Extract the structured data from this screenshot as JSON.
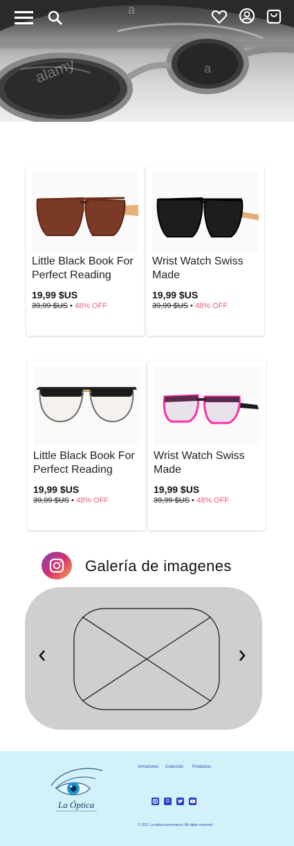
{
  "header": {
    "menu_icon": "menu-icon",
    "search_icon": "search-icon",
    "wishlist_icon": "heart-icon",
    "account_icon": "account-icon",
    "cart_icon": "shopping-bag-icon",
    "hero_watermark": "alamy"
  },
  "products": [
    {
      "title": "Little Black Book For Perfect Reading",
      "price": "19,99 $US",
      "old_price": "39,99 $US",
      "separator": "•",
      "discount": "48% OFF",
      "image": "brown-wood-sunglasses"
    },
    {
      "title": "Wrist Watch Swiss Made",
      "price": "19,99 $US",
      "old_price": "39,99 $US",
      "separator": "•",
      "discount": "48% OFF",
      "image": "black-wood-sunglasses"
    },
    {
      "title": "Little Black Book For Perfect Reading",
      "price": "19,99 $US",
      "old_price": "39,99 $US",
      "separator": "•",
      "discount": "48% OFF",
      "image": "browline-eyeglasses"
    },
    {
      "title": "Wrist Watch Swiss Made",
      "price": "19,99 $US",
      "old_price": "39,99 $US",
      "separator": "•",
      "discount": "48% OFF",
      "image": "pink-purple-eyeglasses"
    }
  ],
  "gallery": {
    "title": "Galería de imagenes",
    "prev_icon": "chevron-left-icon",
    "next_icon": "chevron-right-icon"
  },
  "footer": {
    "logo_text": "La Óptica",
    "links": [
      "Armazones",
      "Colección",
      "Productos"
    ],
    "social_icons": [
      "instagram-icon",
      "google-icon",
      "twitter-icon",
      "youtube-icon"
    ],
    "copyright": "© 2021 La óptica ecommerce. All rights reserved"
  },
  "colors": {
    "discount": "#ef5d7e",
    "footer_bg": "#d2f1f9",
    "footer_link": "#3446b8",
    "gallery_bg": "#cfcfcf"
  }
}
